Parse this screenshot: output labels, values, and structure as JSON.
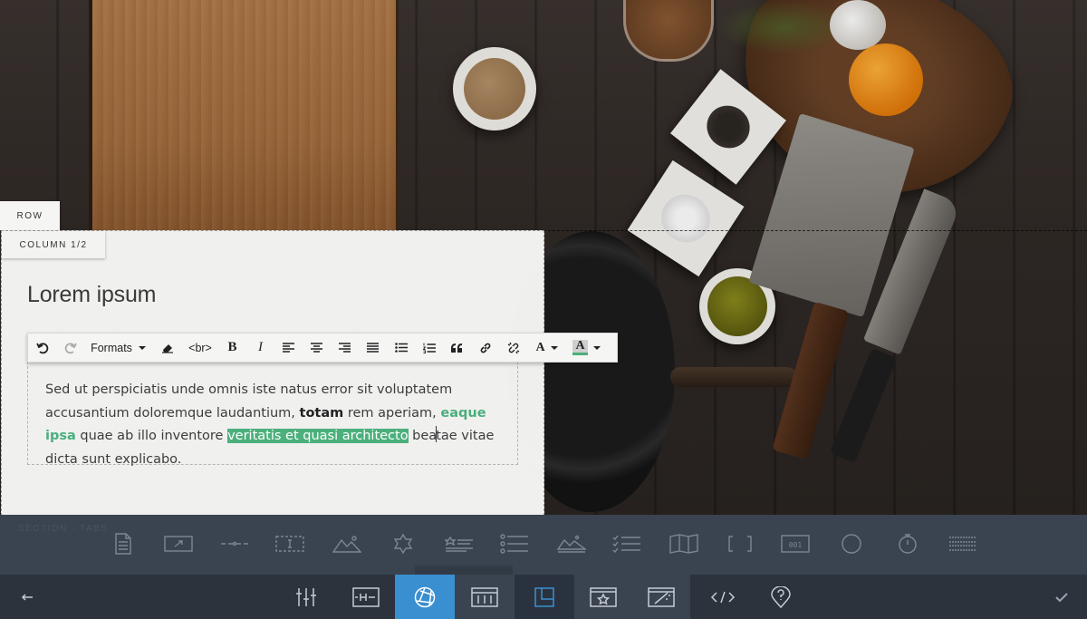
{
  "editor": {
    "row_tab": "ROW",
    "column_tab": "COLUMN 1/2",
    "heading": "Lorem ipsum",
    "paragraph": {
      "part1": "Sed ut perspiciatis unde omnis iste natus error sit voluptatem accusantium doloremque laudantium, ",
      "bold": "totam",
      "part2": " rem aperiam, ",
      "green": "eaque ipsa",
      "part3": " quae ab illo inventore ",
      "selected": "veritatis et quasi architecto",
      "part4a": " bea",
      "part4b": "tae vitae dicta sunt explicabo."
    }
  },
  "toolbar": {
    "formats_label": "Formats",
    "br_label": "<br>",
    "bold_label": "B",
    "italic_label": "I",
    "text_color_label": "A",
    "bg_color_label": "A",
    "bg_color_swatch": "#4cb07c"
  },
  "picker": {
    "section_label": "SECTION - TABS",
    "counter_label": "001"
  },
  "nav": {
    "back_icon": "arrow-left-icon",
    "confirm_icon": "checkmark-icon",
    "active_color": "#3a8fd0"
  }
}
